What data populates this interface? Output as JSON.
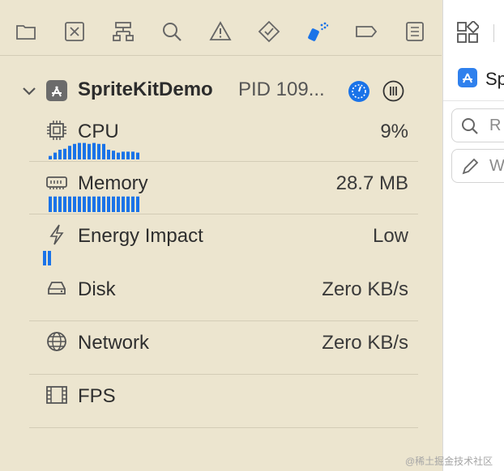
{
  "navigator_toolbar": {
    "icons": [
      "folder-icon",
      "source-control-icon",
      "hierarchy-icon",
      "search-icon",
      "warning-icon",
      "test-diamond-icon",
      "debug-spray-icon",
      "breakpoint-tag-icon",
      "report-list-icon"
    ],
    "active_icon": "debug-spray-icon",
    "accent_color": "#1a73e8"
  },
  "process": {
    "name": "SpriteKitDemo",
    "pid": "PID 109..."
  },
  "gauges": [
    {
      "label": "CPU",
      "value": "9%",
      "icon": "cpu-chip-icon",
      "history": [
        0.18,
        0.35,
        0.5,
        0.55,
        0.7,
        0.8,
        0.85,
        0.85,
        0.8,
        0.85,
        0.8,
        0.8,
        0.5,
        0.45,
        0.35,
        0.4,
        0.4,
        0.4,
        0.35
      ]
    },
    {
      "label": "Memory",
      "value": "28.7 MB",
      "icon": "memory-icon",
      "history": [
        0.8,
        0.8,
        0.8,
        0.8,
        0.8,
        0.8,
        0.8,
        0.8,
        0.8,
        0.8,
        0.8,
        0.8,
        0.8,
        0.8,
        0.8,
        0.8,
        0.8,
        0.8,
        0.8
      ]
    },
    {
      "label": "Energy Impact",
      "value": "Low",
      "icon": "energy-bolt-icon",
      "history": [
        0.75,
        0.75
      ]
    },
    {
      "label": "Disk",
      "value": "Zero KB/s",
      "icon": "disk-icon",
      "history": []
    },
    {
      "label": "Network",
      "value": "Zero KB/s",
      "icon": "network-globe-icon",
      "history": []
    },
    {
      "label": "FPS",
      "value": "",
      "icon": "fps-film-icon",
      "history": []
    }
  ],
  "inspector": {
    "title": "Sp",
    "search_placeholder": "R",
    "edit_placeholder": "W"
  },
  "watermark": "@稀土掘金技术社区"
}
